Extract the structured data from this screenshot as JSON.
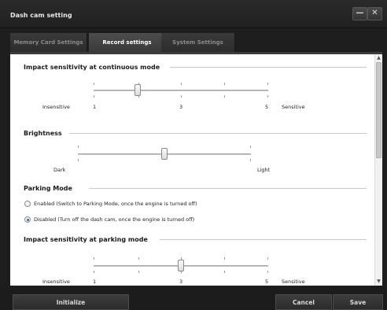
{
  "window": {
    "title": "Dash cam setting",
    "minimize_label": "—",
    "close_label": "✕"
  },
  "tabs": [
    {
      "label": "Memory Card Settings",
      "active": false
    },
    {
      "label": "Record settings",
      "active": true
    },
    {
      "label": "System Settings",
      "active": false
    }
  ],
  "sections": {
    "impact_continuous": {
      "title": "Impact sensitivity at continuous mode",
      "left_label": "Insensitive",
      "right_label": "Sensitive",
      "scale": [
        "1",
        "3",
        "5"
      ],
      "value": 2,
      "min": 1,
      "max": 5
    },
    "brightness": {
      "title": "Brightness",
      "left_label": "Dark",
      "right_label": "Light",
      "value": 0.5
    },
    "parking_mode": {
      "title": "Parking Mode",
      "options": [
        {
          "label": "Enabled (Switch to Parking Mode, once the engine is turned off)",
          "selected": false
        },
        {
          "label": "Disabled (Turn off the dash cam, once the engine is turned off)",
          "selected": true
        }
      ]
    },
    "impact_parking": {
      "title": "Impact sensitivity at parking mode",
      "left_label": "Insensitive",
      "right_label": "Sensitive",
      "scale": [
        "1",
        "3",
        "5"
      ],
      "value": 3,
      "min": 1,
      "max": 5
    }
  },
  "scrollbar": {
    "up": "▲",
    "down": "▼",
    "grip": "≡"
  },
  "footer": {
    "initialize_label": "Initialize",
    "cancel_label": "Cancel",
    "save_label": "Save"
  },
  "colors": {
    "accent_radio": "#2a63c6",
    "window_bg": "#1e1e1e",
    "content_bg": "#ffffff"
  }
}
